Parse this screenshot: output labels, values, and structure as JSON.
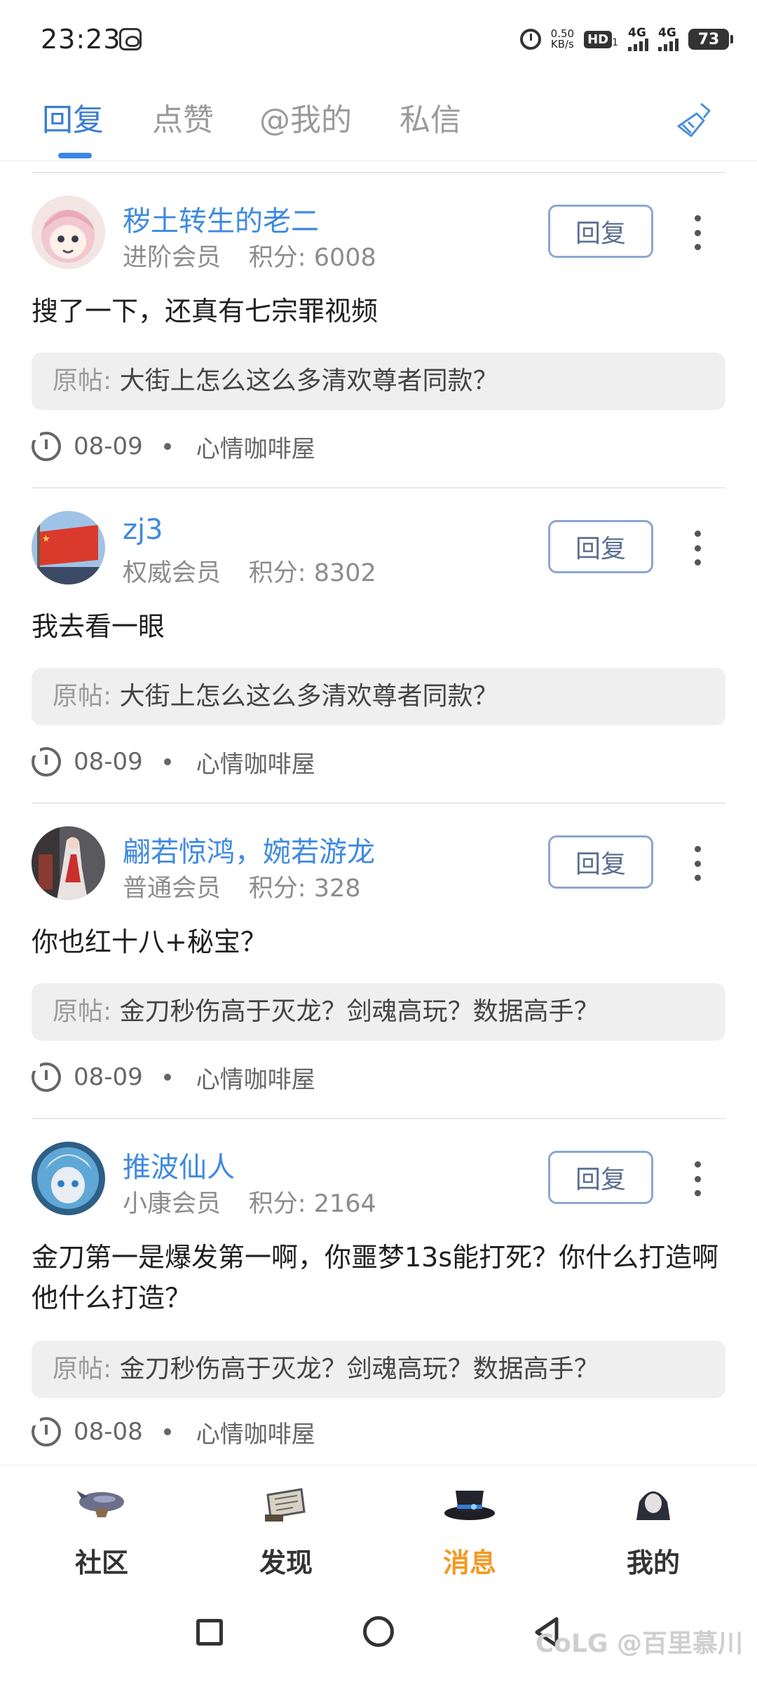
{
  "status_bar": {
    "time": "23:23",
    "net_speed_value": "0.50",
    "net_speed_unit": "KB/s",
    "hd_label": "HD",
    "hd_sub": "1",
    "net1": "4G",
    "net2": "4G",
    "battery": "73"
  },
  "tabs": [
    {
      "label": "回复",
      "active": true
    },
    {
      "label": "点赞",
      "active": false
    },
    {
      "label": "@我的",
      "active": false
    },
    {
      "label": "私信",
      "active": false
    }
  ],
  "reply_button_label": "回复",
  "quote_label": "原帖:",
  "posts": [
    {
      "username": "秽土转生的老二",
      "level": "进阶会员",
      "score_label": "积分:",
      "score": "6008",
      "content": "搜了一下，还真有七宗罪视频",
      "quote": "大街上怎么这么多清欢尊者同款？",
      "date": "08-09",
      "board": "心情咖啡屋"
    },
    {
      "username": "zj3",
      "level": "权威会员",
      "score_label": "积分:",
      "score": "8302",
      "content": "我去看一眼",
      "quote": "大街上怎么这么多清欢尊者同款？",
      "date": "08-09",
      "board": "心情咖啡屋"
    },
    {
      "username": "翩若惊鸿，婉若游龙",
      "level": "普通会员",
      "score_label": "积分:",
      "score": "328",
      "content": "你也红十八+秘宝？",
      "quote": "金刀秒伤高于灭龙？剑魂高玩？数据高手？",
      "date": "08-09",
      "board": "心情咖啡屋"
    },
    {
      "username": "推波仙人",
      "level": "小康会员",
      "score_label": "积分:",
      "score": "2164",
      "content": "金刀第一是爆发第一啊，你噩梦13s能打死？你什么打造啊他什么打造？",
      "quote": "金刀秒伤高于灭龙？剑魂高玩？数据高手？",
      "date": "08-08",
      "board": "心情咖啡屋"
    }
  ],
  "bottom_nav": [
    {
      "label": "社区",
      "icon": "airship-icon",
      "active": false
    },
    {
      "label": "发现",
      "icon": "scroll-icon",
      "active": false
    },
    {
      "label": "消息",
      "icon": "top-hat-icon",
      "active": true
    },
    {
      "label": "我的",
      "icon": "character-avatar-icon",
      "active": false
    }
  ],
  "watermark": "CoLG @百里慕川",
  "colors": {
    "accent_blue": "#3b7ed0",
    "username_blue": "#3f8ae0",
    "active_nav_orange": "#f39a22"
  }
}
